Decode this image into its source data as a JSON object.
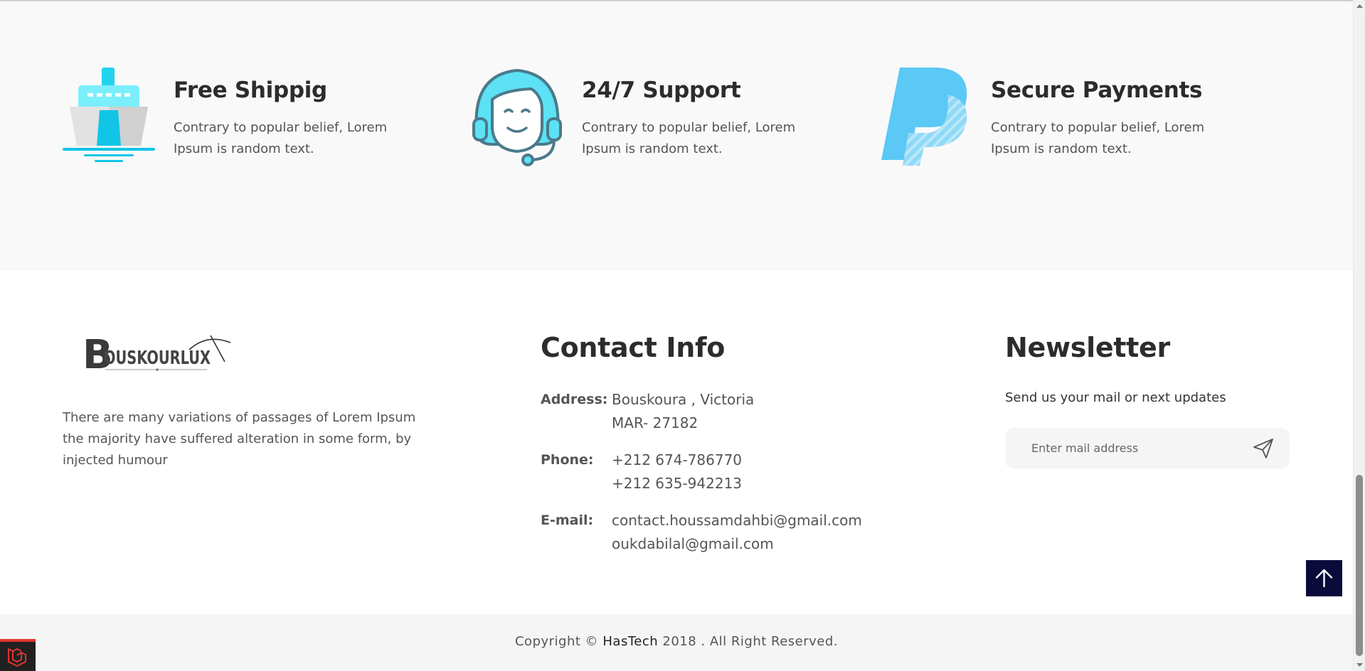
{
  "features": [
    {
      "icon": "ship-icon",
      "title": "Free Shippig",
      "description": "Contrary to popular belief, Lorem Ipsum is random text."
    },
    {
      "icon": "support-agent-icon",
      "title": "24/7 Support",
      "description": "Contrary to popular belief, Lorem Ipsum is random text."
    },
    {
      "icon": "paypal-icon",
      "title": "Secure Payments",
      "description": "Contrary to popular belief, Lorem Ipsum is random text."
    }
  ],
  "footer": {
    "logo_text": "BOUSKOURLUX",
    "about": "There are many variations of passages of Lorem Ipsum the majority have suffered alteration in some form, by injected humour",
    "contact": {
      "title": "Contact Info",
      "address_label": "Address:",
      "address_lines": [
        "Bouskoura , Victoria",
        "MAR- 27182"
      ],
      "phone_label": "Phone:",
      "phone_lines": [
        "+212 674-786770",
        "+212 635-942213"
      ],
      "email_label": "E-mail:",
      "email_lines": [
        "contact.houssamdahbi@gmail.com",
        "oukdabilal@gmail.com"
      ]
    },
    "newsletter": {
      "title": "Newsletter",
      "text": "Send us your mail or next updates",
      "placeholder": "Enter mail address",
      "send_icon": "send-icon"
    }
  },
  "copyright": {
    "prefix": "Copyright © ",
    "brand": "HasTech",
    "suffix": " 2018 . All Right Reserved."
  },
  "colors": {
    "features_bg": "#f9f9f9",
    "copyright_bg": "#f5f5f5",
    "icon_cyan": "#5ce1f5",
    "paypal_blue": "#5bc8f5",
    "to_top_bg": "#0b0b3b",
    "laravel_red": "#e3342f"
  }
}
